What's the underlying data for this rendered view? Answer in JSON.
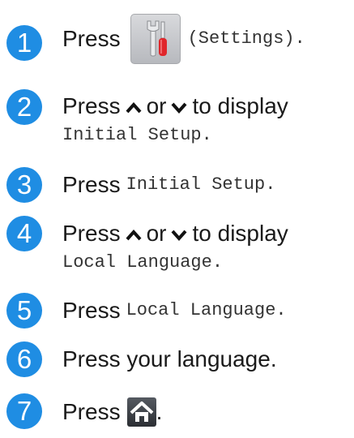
{
  "steps": [
    {
      "number": "1",
      "press": "Press",
      "settings_label": "(Settings).",
      "icon": "settings-icon"
    },
    {
      "number": "2",
      "text_a": "Press",
      "text_b": "or",
      "text_c": "to display",
      "target": "Initial Setup",
      "period": "."
    },
    {
      "number": "3",
      "press": "Press",
      "target": "Initial Setup",
      "period": "."
    },
    {
      "number": "4",
      "text_a": "Press",
      "text_b": "or",
      "text_c": "to display",
      "target": "Local Language",
      "period": "."
    },
    {
      "number": "5",
      "press": "Press",
      "target": "Local Language",
      "period": "."
    },
    {
      "number": "6",
      "text": "Press your language."
    },
    {
      "number": "7",
      "press": "Press",
      "period": ".",
      "icon": "home-icon"
    }
  ],
  "colors": {
    "badge": "#1f8de3",
    "text": "#1a1a1a"
  }
}
